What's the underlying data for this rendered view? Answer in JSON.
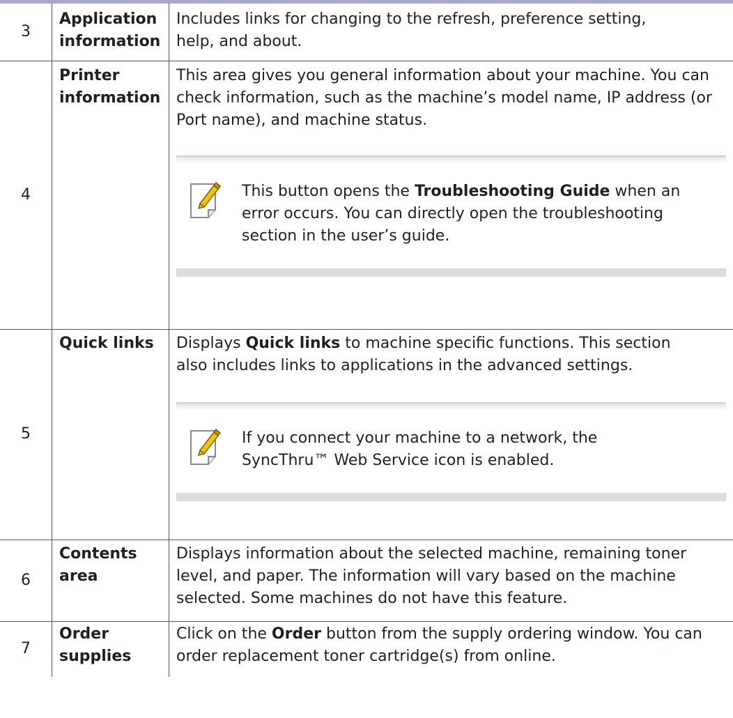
{
  "rows": [
    {
      "num": "3",
      "label_lines": [
        "Application",
        "information"
      ],
      "desc": "Includes links for changing to the refresh, preference setting, help, and about."
    },
    {
      "num": "4",
      "label_lines": [
        "Printer",
        "information"
      ],
      "desc": "This area gives you general information about your machine. You can check information, such as the machine’s model name, IP address (or Port name), and machine status.",
      "note": {
        "before": "This button opens the ",
        "bold": "Troubleshooting Guide",
        "after": " when an error occurs. You can directly open the troubleshooting section in the user’s guide."
      }
    },
    {
      "num": "5",
      "label_lines": [
        "Quick links"
      ],
      "desc_before": "Displays ",
      "desc_bold": "Quick links",
      "desc_after": " to machine specific functions. This section also includes links to applications in the advanced settings.",
      "note": {
        "before": "If you connect your machine to a network, the ",
        "plain": "SyncThru™ Web Service",
        "after": " icon is enabled."
      }
    },
    {
      "num": "6",
      "label_lines": [
        "Contents",
        "area"
      ],
      "desc": "Displays information about the selected machine, remaining toner level, and paper. The information will vary based on the machine selected. Some machines do not have this feature."
    },
    {
      "num": "7",
      "label_lines": [
        "Order",
        "supplies"
      ],
      "desc_before": "Click on the ",
      "desc_bold": "Order",
      "desc_after": " button from the supply ordering window. You can order replacement toner cartridge(s) from online."
    }
  ],
  "icons": {
    "note": "note-pencil-icon"
  },
  "colors": {
    "top_bar": "#a6a7d1",
    "text": "#231f20",
    "pencil": "#f5c400"
  }
}
